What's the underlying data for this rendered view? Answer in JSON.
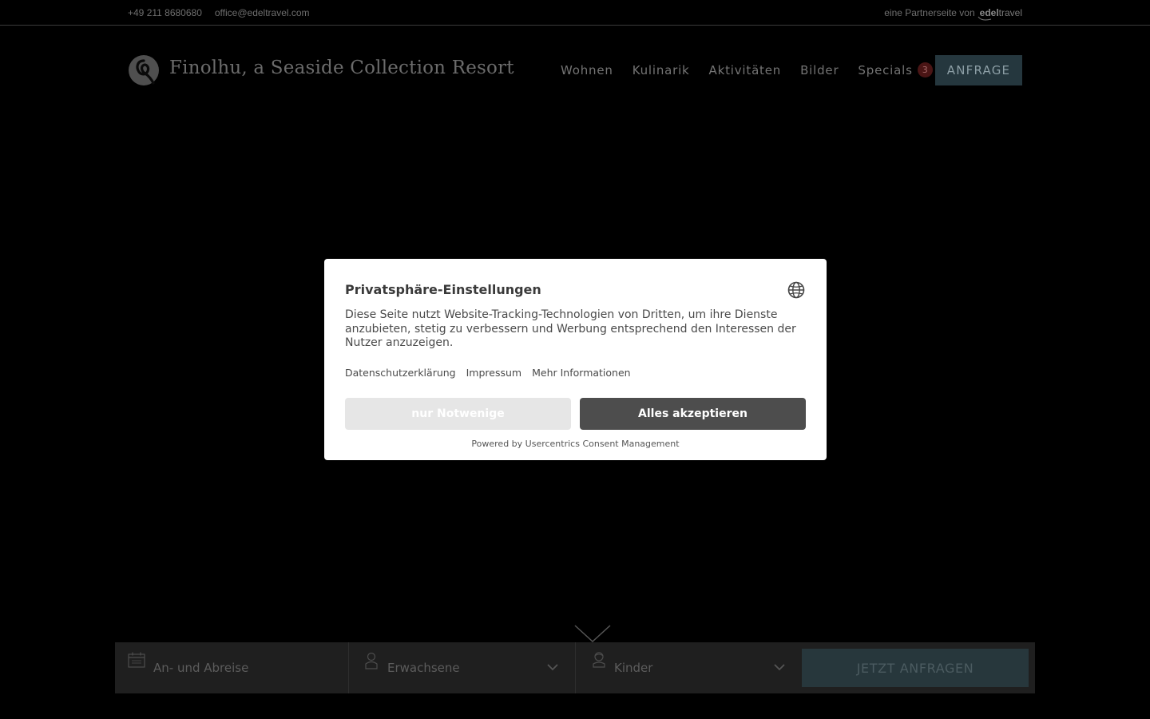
{
  "topbar": {
    "phone": "+49 211 8680680",
    "email": "office@edeltravel.com",
    "partner_text": "eine Partnerseite von",
    "brand_bold": "edel",
    "brand_rest": "travel"
  },
  "header": {
    "resort_name": "Finolhu, a Seaside Collection Resort",
    "nav": [
      {
        "label": "Wohnen"
      },
      {
        "label": "Kulinarik"
      },
      {
        "label": "Aktivitäten"
      },
      {
        "label": "Bilder"
      },
      {
        "label": "Specials",
        "badge": "3"
      }
    ],
    "cta_label": "ANFRAGE"
  },
  "booking": {
    "date_label": "An- und Abreise",
    "adults_label": "Erwachsene",
    "kids_label": "Kinder",
    "submit_label": "JETZT ANFRAGEN"
  },
  "consent": {
    "title": "Privatsphäre-Einstellungen",
    "description": "Diese Seite nutzt Website-Tracking-Technologien von Dritten, um ihre Dienste anzubieten, stetig zu verbessern und Werbung entsprechend den Interessen der Nutzer anzuzeigen.",
    "links": {
      "privacy": "Datenschutzerklärung",
      "imprint": "Impressum",
      "more": "Mehr Informationen"
    },
    "deny_label": "nur Notwenige",
    "accept_label": "Alles akzeptieren",
    "powered_by": "Powered by Usercentrics Consent Management"
  },
  "icons": {
    "logo": "resort-logo-icon",
    "globe": "globe-icon",
    "calendar": "calendar-icon",
    "adult": "person-icon",
    "child": "child-icon",
    "chevron": "chevron-down-icon"
  },
  "colors": {
    "page_bg": "#000000",
    "cta_bg": "#25373e",
    "accept_bg": "#4d4d4d",
    "deny_bg": "#e6e6e6",
    "badge_bg": "#4a1515"
  }
}
